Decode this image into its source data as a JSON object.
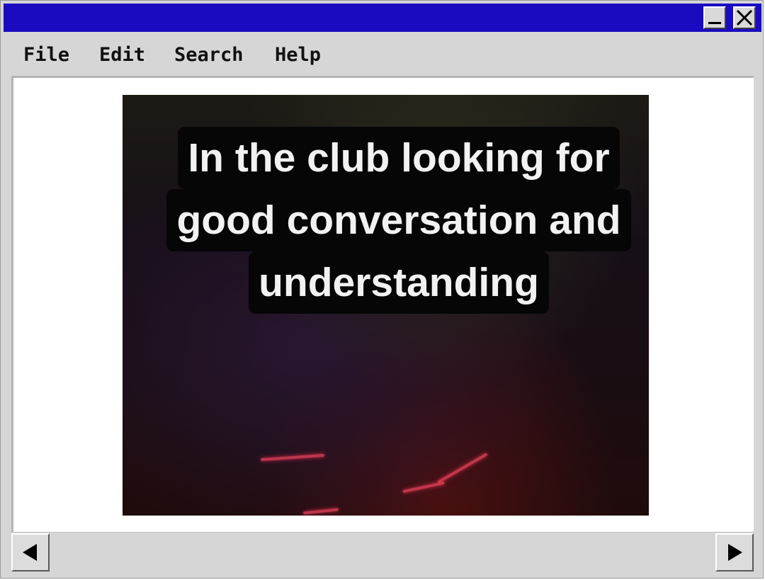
{
  "window": {
    "controls": {
      "minimize_icon": "minimize-icon",
      "close_icon": "close-icon"
    },
    "titlebar_color": "#1a0ac0"
  },
  "menu": {
    "items": [
      {
        "label": "File"
      },
      {
        "label": "Edit"
      },
      {
        "label": "Search"
      },
      {
        "label": "Help"
      }
    ]
  },
  "content": {
    "image": {
      "caption_lines": [
        "In the club looking for",
        "good conversation and",
        "understanding"
      ]
    }
  },
  "scrollbar": {
    "left_icon": "arrow-left-icon",
    "right_icon": "arrow-right-icon"
  }
}
